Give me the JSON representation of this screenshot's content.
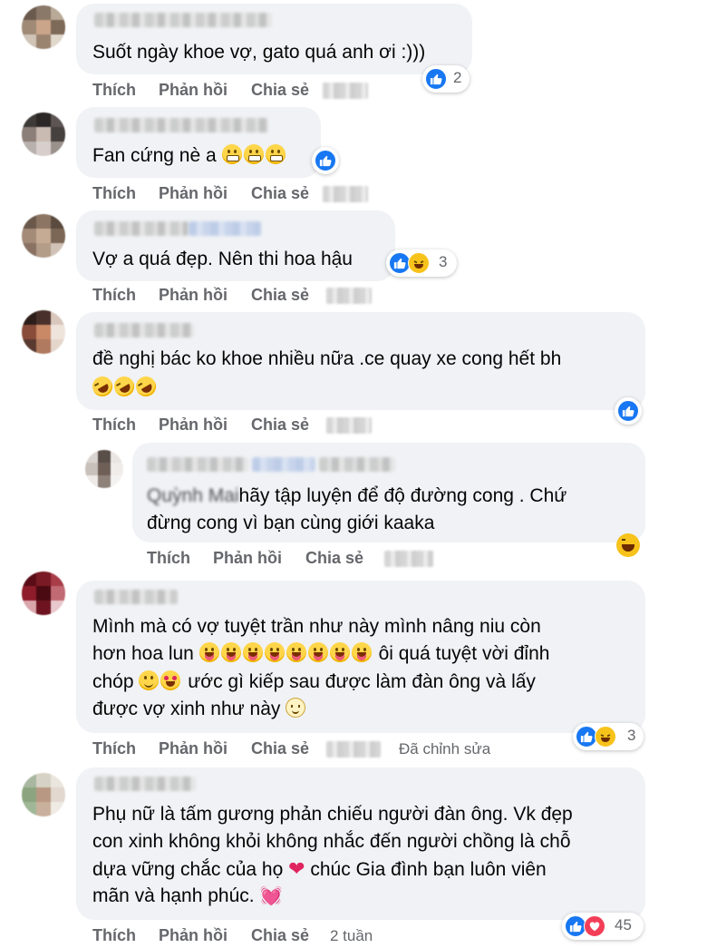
{
  "actions": {
    "like": "Thích",
    "reply": "Phản hồi",
    "share": "Chia sẻ"
  },
  "comments": [
    {
      "text_lines": [
        "Suốt ngày khoe vợ, gato quá anh ơi :)))"
      ],
      "reaction_count": "2",
      "reactions": [
        "like-icon"
      ]
    },
    {
      "text_lines": [
        "Fan cứng nè a"
      ],
      "emojis": [
        "grimacing-face-icon",
        "grimacing-face-icon",
        "grimacing-face-icon"
      ],
      "reactions": [
        "like-icon"
      ]
    },
    {
      "text_lines": [
        "Vợ a quá đẹp. Nên thi hoa hậu"
      ],
      "reaction_count": "3",
      "reactions": [
        "like-icon",
        "haha-icon"
      ]
    },
    {
      "text_lines": [
        "đề nghị bác ko khoe nhiều nữa .ce quay xe cong hết bh"
      ],
      "emojis": [
        "rofl-face-icon",
        "rofl-face-icon",
        "rofl-face-icon"
      ],
      "reactions": [
        "like-icon"
      ]
    },
    {
      "reply_prefix": "Quỳnh Mai",
      "text_lines": [
        "hãy tập luyện để độ đường cong . Chứ",
        "đừng cong vì bạn cùng giới kaaka"
      ],
      "reactions": [
        "haha-icon"
      ]
    },
    {
      "text_lines": [
        "Mình mà có vợ tuyệt trần như này mình nâng niu còn",
        "hơn hoa lun",
        "ôi quá tuyệt vời đỉnh",
        "chóp",
        "ước gì kiếp sau được làm đàn ông và lấy",
        "được vợ xinh như này"
      ],
      "edited_label": "Đã chỉnh sửa",
      "reaction_count": "3",
      "reactions": [
        "like-icon",
        "haha-icon"
      ]
    },
    {
      "text_lines": [
        "Phụ nữ là tấm gương phản chiếu người đàn ông. Vk đẹp",
        "con xinh không khỏi không nhắc đến người chồng là chỗ",
        "dựa vững chắc của họ",
        "chúc Gia đình bạn luôn viên",
        "mãn và hạnh phúc."
      ],
      "time_label": "2 tuần",
      "reaction_count": "45",
      "reactions": [
        "like-icon",
        "love-icon"
      ]
    }
  ],
  "colors": {
    "bubble": "#f0f2f5",
    "action": "#65676b",
    "like": "#1877f2",
    "haha": "#f7c31b",
    "love": "#f33e58"
  }
}
